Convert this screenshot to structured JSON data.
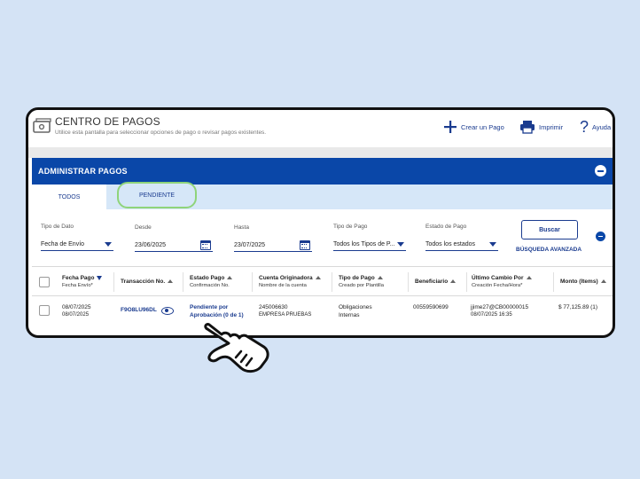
{
  "header": {
    "title": "CENTRO DE PAGOS",
    "subtitle": "Utilice esta pantalla para seleccionar opciones de pago o revisar pagos existentes.",
    "actions": [
      {
        "label": "Crear un Pago",
        "icon": "plus-icon"
      },
      {
        "label": "Imprimir",
        "icon": "printer-icon"
      },
      {
        "label": "Ayuda",
        "icon": "help-icon"
      }
    ]
  },
  "section": {
    "title": "ADMINISTRAR PAGOS"
  },
  "tabs": [
    {
      "label": "TODOS",
      "active": true
    },
    {
      "label": "PENDIENTE",
      "active": false
    }
  ],
  "filters": {
    "tipo_dato": {
      "label": "Tipo de Dato",
      "value": "Fecha de Envío"
    },
    "desde": {
      "label": "Desde",
      "value": "23/06/2025"
    },
    "hasta": {
      "label": "Hasta",
      "value": "23/07/2025"
    },
    "tipo_pago": {
      "label": "Tipo de Pago",
      "value": "Todos los Tipos de P..."
    },
    "estado_pago": {
      "label": "Estado de Pago",
      "value": "Todos los estados"
    },
    "search_label": "Buscar",
    "advanced_label": "BÚSQUEDA AVANZADA"
  },
  "table": {
    "columns": [
      {
        "main": "Fecha Pago",
        "sub": "Fecha Envío*"
      },
      {
        "main": "Transacción No.",
        "sub": ""
      },
      {
        "main": "Estado Pago",
        "sub": "Confirmación No."
      },
      {
        "main": "Cuenta Originadora",
        "sub": "Nombre de la cuenta"
      },
      {
        "main": "Tipo de Pago",
        "sub": "Creado por Plantilla"
      },
      {
        "main": "Beneficiario",
        "sub": ""
      },
      {
        "main": "Último Cambio Por",
        "sub": "Creación Fecha/Hora*"
      },
      {
        "main": "Monto (Items)",
        "sub": ""
      }
    ],
    "rows": [
      {
        "fecha_pago": "08/07/2025",
        "fecha_envio": "08/07/2025",
        "transaccion": "F9O8LU96DL",
        "estado": "Pendiente por Aprobación (0 de 1)",
        "cuenta": "245006630",
        "cuenta_nombre": "EMPRESA PRUEBAS",
        "tipo_pago": "Obligaciones Internas",
        "beneficiario": "00559590699",
        "ultimo_cambio": "jjime27@CB00000015",
        "creacion": "08/07/2025 16:35",
        "monto": "$ 77,125.89 (1)"
      }
    ]
  },
  "colors": {
    "background": "#d4e3f5",
    "primary": "#0a47a8",
    "tab_bar": "#d6e7f8",
    "highlight": "#8fd47a"
  }
}
